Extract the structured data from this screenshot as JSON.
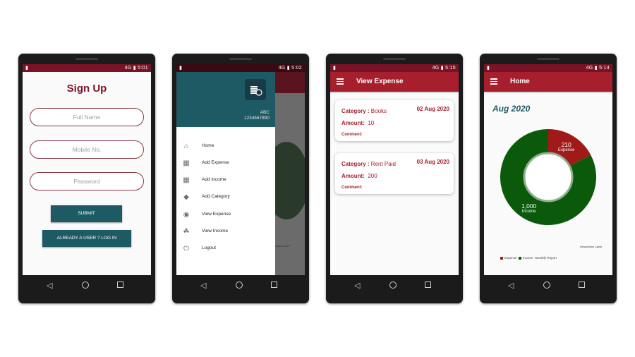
{
  "colors": {
    "brand_red": "#a71e2c",
    "dark_teal": "#1d5a63",
    "income_green": "#0b5a0b",
    "expense_red": "#a11a1a"
  },
  "phones": [
    {
      "status": {
        "time": "5:01",
        "signal": "4G"
      },
      "signup": {
        "title": "Sign Up",
        "full_name_placeholder": "Full Name",
        "mobile_placeholder": "Mobile No.",
        "password_placeholder": "Password",
        "submit_label": "SUBMIT",
        "login_label": "ALREADY A USER ? LOG IN"
      }
    },
    {
      "status": {
        "time": "5:02",
        "signal": "4G"
      },
      "drawer": {
        "user_name": "ABC",
        "user_phone": "1234567890",
        "items": [
          {
            "label": "Home",
            "icon": "home-icon"
          },
          {
            "label": "Add Expense",
            "icon": "add-expense-icon"
          },
          {
            "label": "Add Income",
            "icon": "add-income-icon"
          },
          {
            "label": "Add Category",
            "icon": "category-icon"
          },
          {
            "label": "View Expense",
            "icon": "rupee-icon"
          },
          {
            "label": "View Income",
            "icon": "hand-coin-icon"
          },
          {
            "label": "Logout",
            "icon": "power-icon"
          }
        ]
      },
      "background_desc": "Description Label"
    },
    {
      "status": {
        "time": "5:15",
        "signal": "4G"
      },
      "appbar_title": "View Expense",
      "cards": [
        {
          "category_label": "Category :",
          "category": "Books",
          "date": "02 Aug 2020",
          "amount_label": "Amount:",
          "amount": "10",
          "comment_label": "Comment:"
        },
        {
          "category_label": "Category :",
          "category": "Rent Paid",
          "date": "03 Aug 2020",
          "amount_label": "Amount:",
          "amount": "200",
          "comment_label": "Comment:"
        }
      ]
    },
    {
      "status": {
        "time": "5:14",
        "signal": "4G"
      },
      "appbar_title": "Home",
      "month": "Aug 2020",
      "description_label": "Description Label",
      "legend": {
        "expense": "Expense",
        "income": "Income",
        "report": "Monthly Report"
      },
      "chart_data": {
        "type": "pie",
        "donut": true,
        "slices": [
          {
            "name": "Expense",
            "value": 210,
            "color": "#a11a1a"
          },
          {
            "name": "Income",
            "value": 1000,
            "color": "#0b5a0b"
          }
        ],
        "value_labels": [
          "210",
          "1,000"
        ],
        "slice_labels": [
          "Expense",
          "Income"
        ],
        "legend_position": "bottom-left",
        "description": "Description Label"
      }
    }
  ]
}
